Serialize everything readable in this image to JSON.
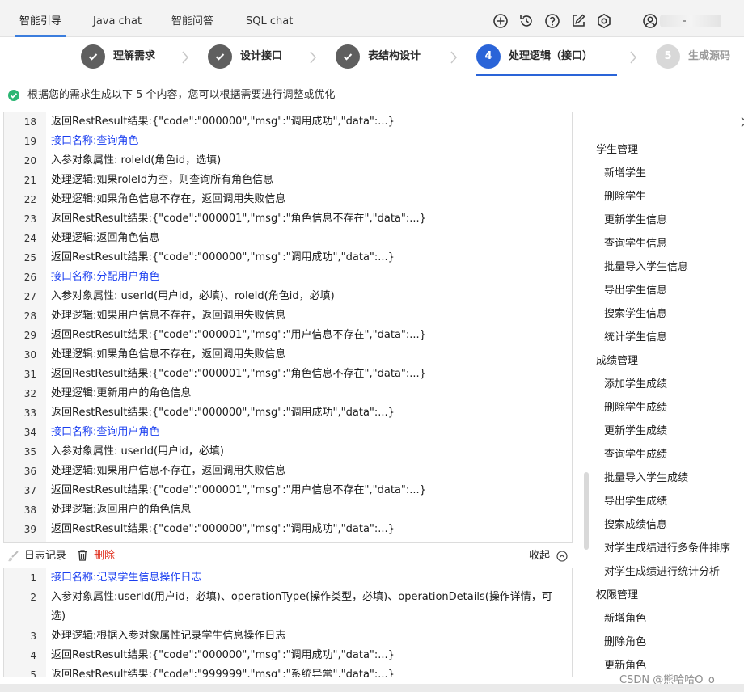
{
  "tabs": [
    {
      "label": "智能引导",
      "active": true
    },
    {
      "label": "Java chat",
      "active": false
    },
    {
      "label": "智能问答",
      "active": false
    },
    {
      "label": "SQL chat",
      "active": false
    }
  ],
  "toolbar_icons": [
    "add-circle-icon",
    "history-icon",
    "help-icon",
    "edit-icon",
    "settings-icon",
    "user-icon"
  ],
  "steps": [
    {
      "label": "理解需求",
      "state": "done",
      "marker": ""
    },
    {
      "label": "设计接口",
      "state": "done",
      "marker": ""
    },
    {
      "label": "表结构设计",
      "state": "done",
      "marker": ""
    },
    {
      "label": "处理逻辑（接口）",
      "state": "current",
      "marker": "4"
    },
    {
      "label": "生成源码",
      "state": "pending",
      "marker": "5"
    }
  ],
  "notice": "根据您的需求生成以下 5 个内容，您可以根据需要进行调整或优化",
  "code_lines": [
    {
      "n": "18",
      "text": "返回RestResult结果:{\"code\":\"000000\",\"msg\":\"调用成功\",\"data\":...}",
      "hl": false
    },
    {
      "n": "19",
      "text": "接口名称:查询角色",
      "hl": true
    },
    {
      "n": "20",
      "text": "入参对象属性: roleId(角色id，选填)",
      "hl": false
    },
    {
      "n": "21",
      "text": "处理逻辑:如果roleId为空，则查询所有角色信息",
      "hl": false
    },
    {
      "n": "22",
      "text": "处理逻辑:如果角色信息不存在，返回调用失败信息",
      "hl": false
    },
    {
      "n": "23",
      "text": "返回RestResult结果:{\"code\":\"000001\",\"msg\":\"角色信息不存在\",\"data\":...}",
      "hl": false
    },
    {
      "n": "24",
      "text": "处理逻辑:返回角色信息",
      "hl": false
    },
    {
      "n": "25",
      "text": "返回RestResult结果:{\"code\":\"000000\",\"msg\":\"调用成功\",\"data\":...}",
      "hl": false
    },
    {
      "n": "26",
      "text": "接口名称:分配用户角色",
      "hl": true
    },
    {
      "n": "27",
      "text": "入参对象属性: userId(用户id，必填)、roleId(角色id，必填)",
      "hl": false
    },
    {
      "n": "28",
      "text": "处理逻辑:如果用户信息不存在，返回调用失败信息",
      "hl": false
    },
    {
      "n": "29",
      "text": "返回RestResult结果:{\"code\":\"000001\",\"msg\":\"用户信息不存在\",\"data\":...}",
      "hl": false
    },
    {
      "n": "30",
      "text": "处理逻辑:如果角色信息不存在，返回调用失败信息",
      "hl": false
    },
    {
      "n": "31",
      "text": "返回RestResult结果:{\"code\":\"000001\",\"msg\":\"角色信息不存在\",\"data\":...}",
      "hl": false
    },
    {
      "n": "32",
      "text": "处理逻辑:更新用户的角色信息",
      "hl": false
    },
    {
      "n": "33",
      "text": "返回RestResult结果:{\"code\":\"000000\",\"msg\":\"调用成功\",\"data\":...}",
      "hl": false
    },
    {
      "n": "34",
      "text": "接口名称:查询用户角色",
      "hl": true
    },
    {
      "n": "35",
      "text": "入参对象属性: userId(用户id，必填)",
      "hl": false
    },
    {
      "n": "36",
      "text": "处理逻辑:如果用户信息不存在，返回调用失败信息",
      "hl": false
    },
    {
      "n": "37",
      "text": "返回RestResult结果:{\"code\":\"000001\",\"msg\":\"用户信息不存在\",\"data\":...}",
      "hl": false
    },
    {
      "n": "38",
      "text": "处理逻辑:返回用户的角色信息",
      "hl": false
    },
    {
      "n": "39",
      "text": "返回RestResult结果:{\"code\":\"000000\",\"msg\":\"调用成功\",\"data\":...}",
      "hl": false
    }
  ],
  "directory": [
    {
      "label": "学生管理",
      "level": 0
    },
    {
      "label": "新增学生",
      "level": 1
    },
    {
      "label": "删除学生",
      "level": 1
    },
    {
      "label": "更新学生信息",
      "level": 1
    },
    {
      "label": "查询学生信息",
      "level": 1
    },
    {
      "label": "批量导入学生信息",
      "level": 1
    },
    {
      "label": "导出学生信息",
      "level": 1
    },
    {
      "label": "搜索学生信息",
      "level": 1
    },
    {
      "label": "统计学生信息",
      "level": 1
    },
    {
      "label": "成绩管理",
      "level": 0
    },
    {
      "label": "添加学生成绩",
      "level": 1
    },
    {
      "label": "删除学生成绩",
      "level": 1
    },
    {
      "label": "更新学生成绩",
      "level": 1
    },
    {
      "label": "查询学生成绩",
      "level": 1
    },
    {
      "label": "批量导入学生成绩",
      "level": 1
    },
    {
      "label": "导出学生成绩",
      "level": 1
    },
    {
      "label": "搜索成绩信息",
      "level": 1
    },
    {
      "label": "对学生成绩进行多条件排序",
      "level": 1
    },
    {
      "label": "对学生成绩进行统计分析",
      "level": 1
    },
    {
      "label": "权限管理",
      "level": 0
    },
    {
      "label": "新增角色",
      "level": 1
    },
    {
      "label": "删除角色",
      "level": 1
    },
    {
      "label": "更新角色",
      "level": 1
    }
  ],
  "log": {
    "title": "日志记录",
    "delete_label": "删除",
    "collapse_label": "收起",
    "lines": [
      {
        "n": "1",
        "text": "接口名称:记录学生信息操作日志",
        "hl": true
      },
      {
        "n": "2",
        "text": "入参对象属性:userId(用户id，必填)、operationType(操作类型，必填)、operationDetails(操作详情，可选)",
        "hl": false
      },
      {
        "n": "3",
        "text": "处理逻辑:根据入参对象属性记录学生信息操作日志",
        "hl": false
      },
      {
        "n": "4",
        "text": "返回RestResult结果:{\"code\":\"000000\",\"msg\":\"调用成功\",\"data\":...}",
        "hl": false
      },
      {
        "n": "5",
        "text": "返回RestResult结果:{\"code\":\"999999\",\"msg\":\"系统异常\",\"data\":...}",
        "hl": false
      }
    ]
  },
  "watermark": "CSDN @熊哈哈O_o",
  "colors": {
    "accent": "#2a64d8",
    "highlight_text": "#1a3ef0",
    "delete": "#e0301e",
    "success": "#2bb673"
  }
}
